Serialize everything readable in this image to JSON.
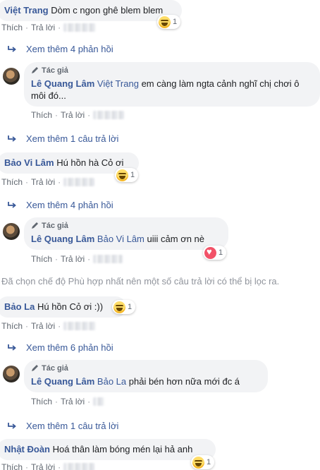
{
  "common": {
    "like": "Thích",
    "reply": "Trả lời",
    "sep": "·",
    "author_badge": "Tác giả"
  },
  "comments": [
    {
      "name": "Việt Trang",
      "text": "Dòm c ngon ghê blem blem",
      "reaction": {
        "type": "haha",
        "count": "1"
      }
    },
    {
      "name": "Bảo Vi Lâm",
      "text": "Hú hồn hà Cỏ ơi",
      "reaction": {
        "type": "haha",
        "count": "1"
      }
    },
    {
      "name": "Bảo La",
      "text": "Hú hồn Cỏ ơi :))",
      "reaction": {
        "type": "haha",
        "count": "1"
      }
    },
    {
      "name": "Nhật Đoàn",
      "text": "Hoá thân làm bóng mén lại hả anh",
      "reaction": {
        "type": "haha",
        "count": "1"
      }
    }
  ],
  "replies": [
    {
      "name": "Lê Quang Lâm",
      "mention": "Việt Trang",
      "text": "em càng làm ngta cảnh nghĩ chị chơi ô môi đó..."
    },
    {
      "name": "Lê Quang Lâm",
      "mention": "Bảo Vi Lâm",
      "text": "uiii cảm ơn nè",
      "reaction": {
        "type": "love",
        "count": "1"
      }
    },
    {
      "name": "Lê Quang Lâm",
      "mention": "Bảo La",
      "text": "phải bén hơn nữa mới đc á"
    }
  ],
  "more_replies": [
    "Xem thêm 4 phản hồi",
    "Xem thêm 1 câu trả lời",
    "Xem thêm 4 phản hồi",
    "Xem thêm 6 phản hồi",
    "Xem thêm 1 câu trả lời"
  ],
  "filter_notice": "Đã chọn chế độ Phù hợp nhất nên một số câu trả lời có thể bị lọc ra.",
  "colors": {
    "name_link": "#385898",
    "bubble_bg": "#f2f3f5",
    "meta_text": "#606770",
    "notice_text": "#90949c"
  }
}
